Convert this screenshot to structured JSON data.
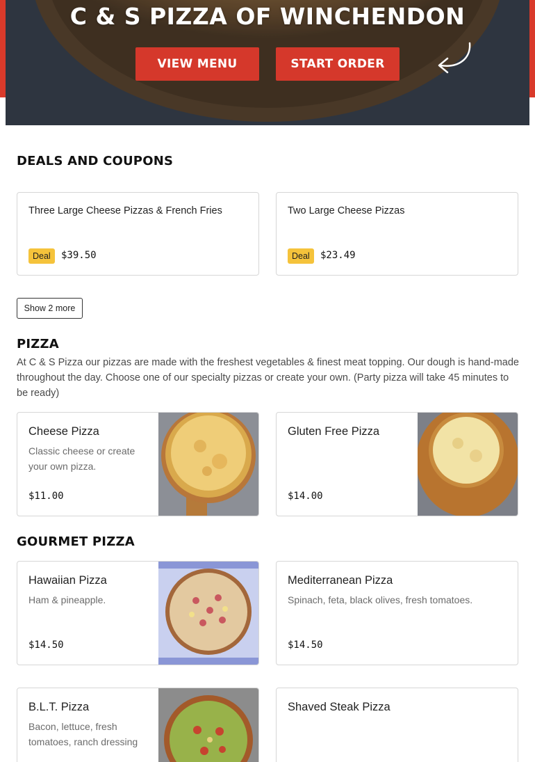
{
  "hero": {
    "title": "C & S PIZZA OF WINCHENDON",
    "view_menu_label": "VIEW MENU",
    "start_order_label": "START ORDER"
  },
  "deals": {
    "heading": "DEALS AND COUPONS",
    "items": [
      {
        "title": "Three Large Cheese Pizzas & French Fries",
        "badge": "Deal",
        "price": "$39.50"
      },
      {
        "title": "Two Large Cheese Pizzas",
        "badge": "Deal",
        "price": "$23.49"
      }
    ],
    "show_more_label": "Show 2 more"
  },
  "pizza": {
    "heading": "PIZZA",
    "description": "At C & S Pizza our pizzas are made with the freshest vegetables & finest meat topping. Our dough is hand-made throughout the day. Choose one of our specialty pizzas or create your own. (Party pizza will take 45 minutes to be ready)",
    "items": [
      {
        "name": "Cheese Pizza",
        "description": "Classic cheese or create your own pizza.",
        "price": "$11.00"
      },
      {
        "name": "Gluten Free Pizza",
        "description": "",
        "price": "$14.00"
      }
    ]
  },
  "gourmet": {
    "heading": "GOURMET PIZZA",
    "items": [
      {
        "name": "Hawaiian Pizza",
        "description": "Ham & pineapple.",
        "price": "$14.50"
      },
      {
        "name": "Mediterranean Pizza",
        "description": "Spinach, feta, black olives, fresh tomatoes.",
        "price": "$14.50"
      },
      {
        "name": "B.L.T. Pizza",
        "description": "Bacon, lettuce, fresh tomatoes, ranch dressing",
        "price": ""
      },
      {
        "name": "Shaved Steak Pizza",
        "description": "",
        "price": ""
      }
    ]
  },
  "colors": {
    "brand_red": "#d5382b",
    "badge_yellow": "#f5c33b"
  }
}
